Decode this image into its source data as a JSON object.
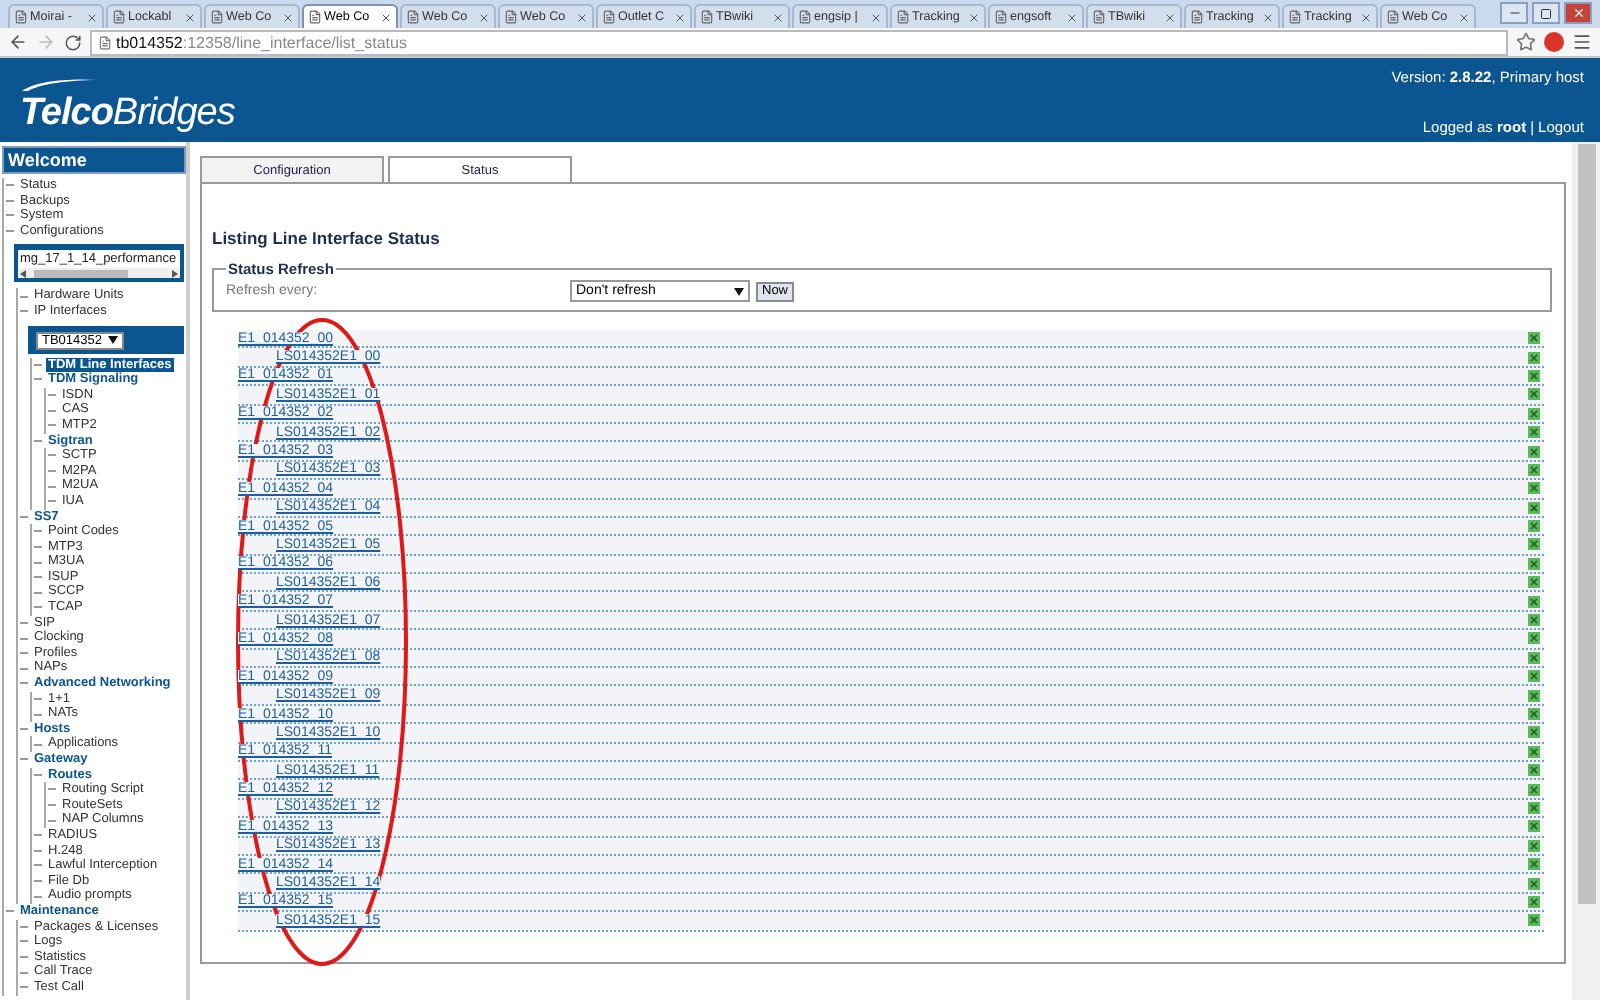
{
  "browser": {
    "tabs": [
      {
        "label": "Moirai -",
        "selected": false
      },
      {
        "label": "Lockabl",
        "selected": false
      },
      {
        "label": "Web Co",
        "selected": false
      },
      {
        "label": "Web Co",
        "selected": true
      },
      {
        "label": "Web Co",
        "selected": false
      },
      {
        "label": "Web Co",
        "selected": false
      },
      {
        "label": "Outlet C",
        "selected": false
      },
      {
        "label": "TBwiki",
        "selected": false
      },
      {
        "label": "engsip |",
        "selected": false
      },
      {
        "label": "Tracking",
        "selected": false
      },
      {
        "label": "engsoft",
        "selected": false
      },
      {
        "label": "TBwiki",
        "selected": false
      },
      {
        "label": "Tracking",
        "selected": false
      },
      {
        "label": "Tracking",
        "selected": false
      },
      {
        "label": "Web Co",
        "selected": false
      }
    ],
    "address": {
      "host": "tb014352",
      "path": ":12358/line_interface/list_status"
    }
  },
  "header": {
    "logo": "**Telco**Bridges",
    "version": "Version: **2.8.22**, Primary host",
    "login": "Logged as **root**",
    "separator": "|",
    "logout": "Logout"
  },
  "sidebar": {
    "title": "Welcome",
    "items": [
      {
        "kind": "link",
        "label": "Status",
        "selected": false
      },
      {
        "kind": "link",
        "label": "Backups",
        "selected": false
      },
      {
        "kind": "link",
        "label": "System",
        "selected": false
      },
      {
        "kind": "link",
        "label": "Configurations",
        "selected": false
      },
      {
        "kind": "config",
        "value": "mg_17_1_14_performance",
        "children": [
          {
            "kind": "link",
            "label": "Hardware Units",
            "selected": false
          },
          {
            "kind": "link",
            "label": "IP Interfaces",
            "selected": false
          },
          {
            "kind": "device",
            "value": "TB014352",
            "children": [
              {
                "kind": "link",
                "label": "TDM Line Interfaces",
                "selected": true
              },
              {
                "kind": "header",
                "label": "TDM Signaling",
                "selected": false,
                "children": [
                  {
                    "kind": "link",
                    "label": "ISDN",
                    "selected": false
                  },
                  {
                    "kind": "link",
                    "label": "CAS",
                    "selected": false
                  },
                  {
                    "kind": "link",
                    "label": "MTP2",
                    "selected": false
                  }
                ]
              },
              {
                "kind": "header",
                "label": "Sigtran",
                "selected": false,
                "children": [
                  {
                    "kind": "link",
                    "label": "SCTP",
                    "selected": false
                  },
                  {
                    "kind": "link",
                    "label": "M2PA",
                    "selected": false
                  },
                  {
                    "kind": "link",
                    "label": "M2UA",
                    "selected": false
                  },
                  {
                    "kind": "link",
                    "label": "IUA",
                    "selected": false
                  }
                ]
              }
            ]
          },
          {
            "kind": "header",
            "label": "SS7",
            "selected": false,
            "children": [
              {
                "kind": "link",
                "label": "Point Codes",
                "selected": false
              },
              {
                "kind": "link",
                "label": "MTP3",
                "selected": false
              },
              {
                "kind": "link",
                "label": "M3UA",
                "selected": false
              },
              {
                "kind": "link",
                "label": "ISUP",
                "selected": false
              },
              {
                "kind": "link",
                "label": "SCCP",
                "selected": false
              },
              {
                "kind": "link",
                "label": "TCAP",
                "selected": false
              }
            ]
          },
          {
            "kind": "link",
            "label": "SIP",
            "selected": false
          },
          {
            "kind": "link",
            "label": "Clocking",
            "selected": false
          },
          {
            "kind": "link",
            "label": "Profiles",
            "selected": false
          },
          {
            "kind": "link",
            "label": "NAPs",
            "selected": false
          },
          {
            "kind": "header",
            "label": "Advanced Networking",
            "selected": false,
            "children": [
              {
                "kind": "link",
                "label": "1+1",
                "selected": false
              },
              {
                "kind": "link",
                "label": "NATs",
                "selected": false
              }
            ]
          },
          {
            "kind": "header",
            "label": "Hosts",
            "selected": false,
            "children": [
              {
                "kind": "link",
                "label": "Applications",
                "selected": false
              }
            ]
          },
          {
            "kind": "header",
            "label": "Gateway",
            "selected": false,
            "children": [
              {
                "kind": "header",
                "label": "Routes",
                "selected": false,
                "children": [
                  {
                    "kind": "link",
                    "label": "Routing Script",
                    "selected": false
                  },
                  {
                    "kind": "link",
                    "label": "RouteSets",
                    "selected": false
                  },
                  {
                    "kind": "link",
                    "label": "NAP Columns",
                    "selected": false
                  }
                ]
              },
              {
                "kind": "link",
                "label": "RADIUS",
                "selected": false
              },
              {
                "kind": "link",
                "label": "H.248",
                "selected": false
              },
              {
                "kind": "link",
                "label": "Lawful Interception",
                "selected": false
              },
              {
                "kind": "link",
                "label": "File Db",
                "selected": false
              },
              {
                "kind": "link",
                "label": "Audio prompts",
                "selected": false
              }
            ]
          }
        ]
      },
      {
        "kind": "header",
        "label": "Maintenance",
        "selected": false,
        "children": [
          {
            "kind": "link",
            "label": "Packages & Licenses",
            "selected": false
          },
          {
            "kind": "link",
            "label": "Logs",
            "selected": false
          },
          {
            "kind": "link",
            "label": "Statistics",
            "selected": false
          },
          {
            "kind": "link",
            "label": "Call Trace",
            "selected": false
          },
          {
            "kind": "link",
            "label": "Test Call",
            "selected": false
          }
        ]
      }
    ]
  },
  "main": {
    "tabs": [
      {
        "label": "Configuration",
        "selected": false
      },
      {
        "label": "Status",
        "selected": true
      }
    ],
    "heading": "Listing Line Interface Status",
    "refresh": {
      "legend": "Status Refresh",
      "label": "Refresh every:",
      "select": "Don't refresh",
      "button": "Now"
    },
    "lines": [
      {
        "name": "E1_014352_00",
        "children": [
          {
            "name": "LS014352E1_00"
          }
        ]
      },
      {
        "name": "E1_014352_01",
        "children": [
          {
            "name": "LS014352E1_01"
          }
        ]
      },
      {
        "name": "E1_014352_02",
        "children": [
          {
            "name": "LS014352E1_02"
          }
        ]
      },
      {
        "name": "E1_014352_03",
        "children": [
          {
            "name": "LS014352E1_03"
          }
        ]
      },
      {
        "name": "E1_014352_04",
        "children": [
          {
            "name": "LS014352E1_04"
          }
        ]
      },
      {
        "name": "E1_014352_05",
        "children": [
          {
            "name": "LS014352E1_05"
          }
        ]
      },
      {
        "name": "E1_014352_06",
        "children": [
          {
            "name": "LS014352E1_06"
          }
        ]
      },
      {
        "name": "E1_014352_07",
        "children": [
          {
            "name": "LS014352E1_07"
          }
        ]
      },
      {
        "name": "E1_014352_08",
        "children": [
          {
            "name": "LS014352E1_08"
          }
        ]
      },
      {
        "name": "E1_014352_09",
        "children": [
          {
            "name": "LS014352E1_09"
          }
        ]
      },
      {
        "name": "E1_014352_10",
        "children": [
          {
            "name": "LS014352E1_10"
          }
        ]
      },
      {
        "name": "E1_014352_11",
        "children": [
          {
            "name": "LS014352E1_11"
          }
        ]
      },
      {
        "name": "E1_014352_12",
        "children": [
          {
            "name": "LS014352E1_12"
          }
        ]
      },
      {
        "name": "E1_014352_13",
        "children": [
          {
            "name": "LS014352E1_13"
          }
        ]
      },
      {
        "name": "E1_014352_14",
        "children": [
          {
            "name": "LS014352E1_14"
          }
        ]
      },
      {
        "name": "E1_014352_15",
        "children": [
          {
            "name": "LS014352E1_15"
          }
        ]
      }
    ]
  }
}
